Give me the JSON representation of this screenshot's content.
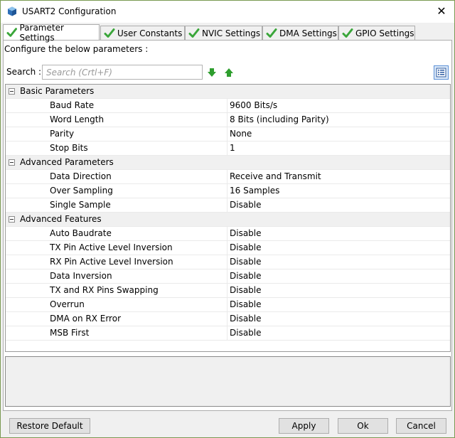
{
  "window": {
    "title": "USART2 Configuration",
    "close_label": "✕"
  },
  "tabs": [
    {
      "label": "Parameter Settings",
      "active": true
    },
    {
      "label": "User Constants",
      "active": false
    },
    {
      "label": "NVIC Settings",
      "active": false
    },
    {
      "label": "DMA Settings",
      "active": false
    },
    {
      "label": "GPIO Settings",
      "active": false
    }
  ],
  "content": {
    "configure_label": "Configure the below parameters :",
    "search_label": "Search :",
    "search_placeholder": "Search (Crtl+F)",
    "search_value": ""
  },
  "groups": [
    {
      "name": "Basic Parameters",
      "params": [
        {
          "name": "Baud Rate",
          "value": "9600 Bits/s"
        },
        {
          "name": "Word Length",
          "value": "8 Bits (including Parity)"
        },
        {
          "name": "Parity",
          "value": "None"
        },
        {
          "name": "Stop Bits",
          "value": "1"
        }
      ]
    },
    {
      "name": "Advanced Parameters",
      "params": [
        {
          "name": "Data Direction",
          "value": "Receive and Transmit"
        },
        {
          "name": "Over Sampling",
          "value": "16 Samples"
        },
        {
          "name": "Single Sample",
          "value": "Disable"
        }
      ]
    },
    {
      "name": "Advanced Features",
      "params": [
        {
          "name": "Auto Baudrate",
          "value": "Disable"
        },
        {
          "name": "TX Pin Active Level Inversion",
          "value": "Disable"
        },
        {
          "name": "RX Pin Active Level Inversion",
          "value": "Disable"
        },
        {
          "name": "Data Inversion",
          "value": "Disable"
        },
        {
          "name": "TX and RX Pins Swapping",
          "value": "Disable"
        },
        {
          "name": "Overrun",
          "value": "Disable"
        },
        {
          "name": "DMA on RX Error",
          "value": "Disable"
        },
        {
          "name": "MSB First",
          "value": "Disable"
        }
      ]
    }
  ],
  "buttons": {
    "restore_default": "Restore Default",
    "apply": "Apply",
    "ok": "Ok",
    "cancel": "Cancel"
  },
  "colors": {
    "check_green": "#3aa63a",
    "arrow_green": "#2e9e2e",
    "accent_blue": "#5a8fd6"
  },
  "icons": {
    "title": "cube-icon",
    "tab_status": "checkmark-icon",
    "search_down": "arrow-down-icon",
    "search_up": "arrow-up-icon",
    "view_toggle": "list-view-icon",
    "group_toggle": "collapse-icon"
  }
}
